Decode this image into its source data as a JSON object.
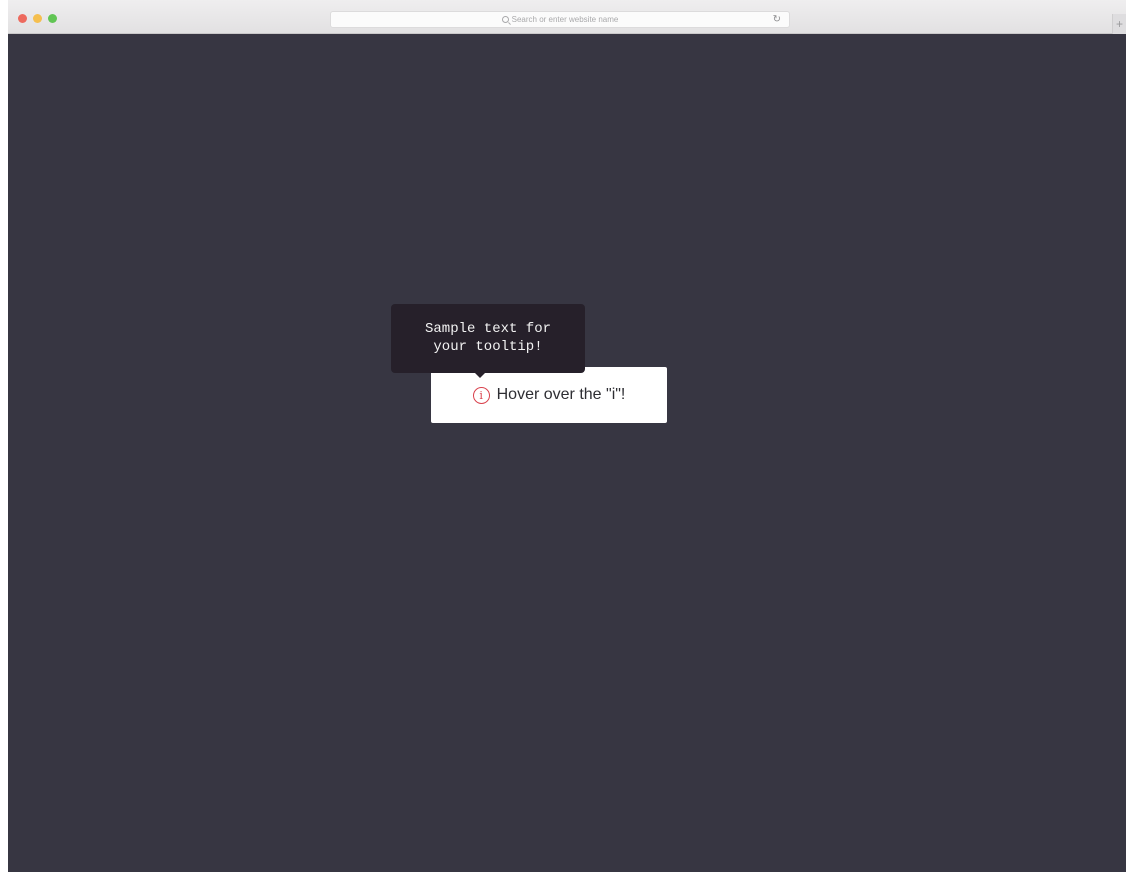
{
  "browser": {
    "address_placeholder": "Search or enter website name",
    "reload_glyph": "↻",
    "new_tab_glyph": "+",
    "traffic_lights": {
      "close_color": "#ed6a5e",
      "minimize_color": "#f5bf4f",
      "zoom_color": "#61c554"
    }
  },
  "page": {
    "background_color": "#373642",
    "card": {
      "icon_glyph": "i",
      "icon_color": "#d9424d",
      "label": "Hover over the \"i\"!"
    },
    "tooltip": {
      "line1": "Sample text for",
      "line2": "your tooltip!",
      "background_color": "#26202a"
    }
  }
}
